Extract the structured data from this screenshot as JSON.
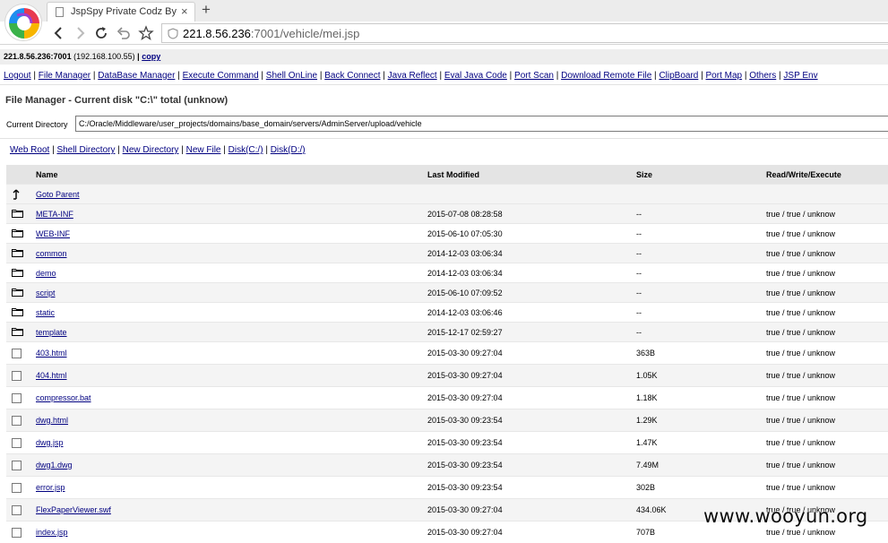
{
  "browser": {
    "tab_title": "JspSpy Private Codz By - ",
    "tab_close": "×",
    "new_tab": "+",
    "url_host": "221.8.56.236",
    "url_rest": ":7001/vehicle/mei.jsp"
  },
  "host_bar": {
    "host": "221.8.56.236:7001",
    "ip": "(192.168.100.55)",
    "separator": "|",
    "copy_label": "copy"
  },
  "menu": {
    "items": [
      "Logout",
      "File Manager",
      "DataBase Manager",
      "Execute Command",
      "Shell OnLine",
      "Back Connect",
      "Java Reflect",
      "Eval Java Code",
      "Port Scan",
      "Download Remote File",
      "ClipBoard",
      "Port Map",
      "Others",
      "JSP Env"
    ],
    "separator": " | "
  },
  "file_manager": {
    "title": "File Manager - Current disk \"C:\\\" total (unknow)",
    "current_dir_label": "Current Directory",
    "current_dir_value": "C:/Oracle/Middleware/user_projects/domains/base_domain/servers/AdminServer/upload/vehicle",
    "links": [
      "Web Root",
      "Shell Directory",
      "New Directory",
      "New File",
      "Disk(C:/)",
      "Disk(D:/)"
    ],
    "link_separator": " | "
  },
  "table": {
    "headers": {
      "name": "Name",
      "modified": "Last Modified",
      "size": "Size",
      "perm": "Read/Write/Execute"
    },
    "parent_label": "Goto Parent",
    "directories": [
      {
        "name": "META-INF",
        "modified": "2015-07-08 08:28:58",
        "size": "--",
        "perm": "true / true / unknow"
      },
      {
        "name": "WEB-INF",
        "modified": "2015-06-10 07:05:30",
        "size": "--",
        "perm": "true / true / unknow"
      },
      {
        "name": "common",
        "modified": "2014-12-03 03:06:34",
        "size": "--",
        "perm": "true / true / unknow"
      },
      {
        "name": "demo",
        "modified": "2014-12-03 03:06:34",
        "size": "--",
        "perm": "true / true / unknow"
      },
      {
        "name": "script",
        "modified": "2015-06-10 07:09:52",
        "size": "--",
        "perm": "true / true / unknow"
      },
      {
        "name": "static",
        "modified": "2014-12-03 03:06:46",
        "size": "--",
        "perm": "true / true / unknow"
      },
      {
        "name": "template",
        "modified": "2015-12-17 02:59:27",
        "size": "--",
        "perm": "true / true / unknow"
      }
    ],
    "files": [
      {
        "name": "403.html",
        "modified": "2015-03-30 09:27:04",
        "size": "363B",
        "perm": "true / true / unknow"
      },
      {
        "name": "404.html",
        "modified": "2015-03-30 09:27:04",
        "size": "1.05K",
        "perm": "true / true / unknow"
      },
      {
        "name": "compressor.bat",
        "modified": "2015-03-30 09:27:04",
        "size": "1.18K",
        "perm": "true / true / unknow"
      },
      {
        "name": "dwg.html",
        "modified": "2015-03-30 09:23:54",
        "size": "1.29K",
        "perm": "true / true / unknow"
      },
      {
        "name": "dwg.jsp",
        "modified": "2015-03-30 09:23:54",
        "size": "1.47K",
        "perm": "true / true / unknow"
      },
      {
        "name": "dwg1.dwg",
        "modified": "2015-03-30 09:23:54",
        "size": "7.49M",
        "perm": "true / true / unknow"
      },
      {
        "name": "error.jsp",
        "modified": "2015-03-30 09:23:54",
        "size": "302B",
        "perm": "true / true / unknow"
      },
      {
        "name": "FlexPaperViewer.swf",
        "modified": "2015-03-30 09:27:04",
        "size": "434.06K",
        "perm": "true / true / unknow"
      },
      {
        "name": "index.jsp",
        "modified": "2015-03-30 09:27:04",
        "size": "707B",
        "perm": "true / true / unknow"
      }
    ]
  },
  "watermark": "www.wooyun.org"
}
